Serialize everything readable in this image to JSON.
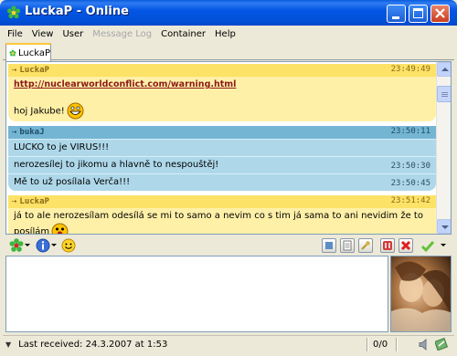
{
  "window": {
    "title": "LuckaP - Online"
  },
  "menu": [
    "File",
    "View",
    "User",
    "Message Log",
    "Container",
    "Help"
  ],
  "menu_disabled_index": 3,
  "tab": {
    "label": "LuckaP"
  },
  "messages": [
    {
      "author": "LuckaP",
      "time": "23:49:49",
      "color": "yellow",
      "lines": [
        {
          "text": "http://nuclearworldconflict.com/warning.html",
          "link": true
        },
        {
          "text": "hoj Jakube!",
          "smiley": "big-grin"
        }
      ]
    },
    {
      "author": "bukaJ",
      "time": "23:50:11",
      "color": "blue",
      "lines": [
        {
          "text": "LUCKO to je VIRUS!!!"
        },
        {
          "text": " nerozesílej to jikomu a hlavně to nespouštěj!",
          "time": "23:50:30"
        },
        {
          "text": " Mě to už posílala Verča!!!",
          "time": "23:50:45"
        }
      ]
    },
    {
      "author": "LuckaP",
      "time": "23:51:42",
      "color": "yellow",
      "lines": [
        {
          "text": "já to ale nerozesílam odesílá se mi to samo a nevim co s tim já sama to ani nevidim že to posílám",
          "smiley": "shocked"
        }
      ]
    }
  ],
  "input": {
    "value": ""
  },
  "status": {
    "last_received": "Last received: 24.3.2007 at 1:53",
    "counter": "0/0"
  },
  "colors": {
    "accent": "#0054e3",
    "yellow_header": "#fce266",
    "blue_header": "#74b5d4"
  }
}
